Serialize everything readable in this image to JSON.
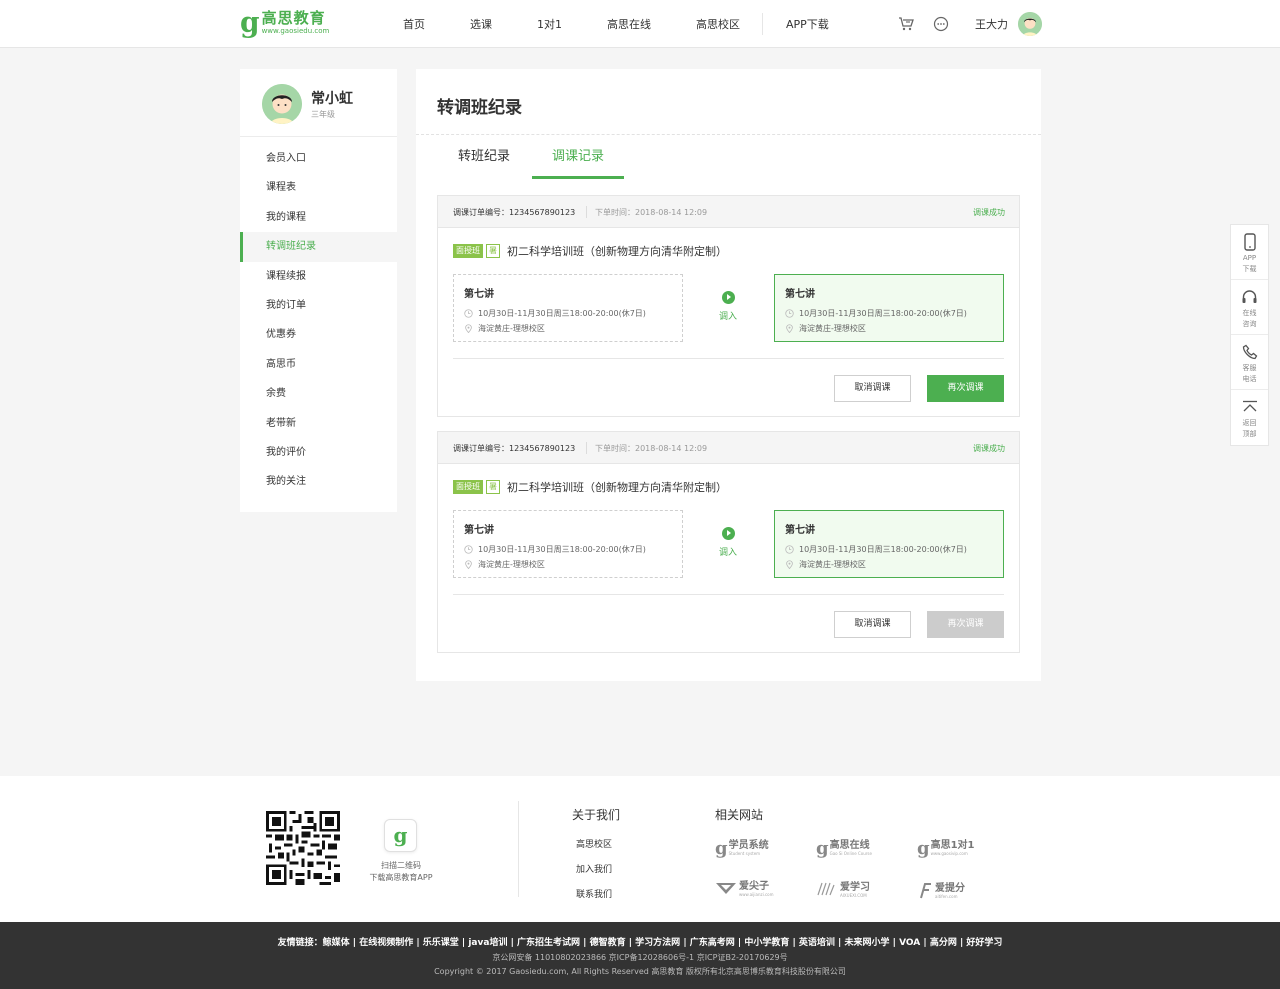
{
  "brand": {
    "name": "高思教育",
    "url": "www.gaosiedu.com",
    "accent": "#4caf50"
  },
  "nav": {
    "items": [
      "首页",
      "选课",
      "1对1",
      "高思在线",
      "高思校区",
      "APP下载"
    ]
  },
  "header": {
    "username": "王大力"
  },
  "profile": {
    "name": "常小虹",
    "grade": "三年级"
  },
  "sidebar": {
    "items": [
      {
        "label": "会员入口"
      },
      {
        "label": "课程表"
      },
      {
        "label": "我的课程"
      },
      {
        "label": "转调班纪录",
        "active": true
      },
      {
        "label": "课程续报"
      },
      {
        "label": "我的订单"
      },
      {
        "label": "优惠券"
      },
      {
        "label": "高思币"
      },
      {
        "label": "余费"
      },
      {
        "label": "老带新"
      },
      {
        "label": "我的评价"
      },
      {
        "label": "我的关注"
      }
    ]
  },
  "main": {
    "title": "转调班纪录",
    "tabs": [
      {
        "label": "转班纪录",
        "active": false
      },
      {
        "label": "调课记录",
        "active": true
      }
    ]
  },
  "records": [
    {
      "order_label": "调课订单编号：1234567890123",
      "time_label": "下单时间：2018-08-14 12:09",
      "status": "调课成功",
      "tag_type": "面授班",
      "tag_season": "暑",
      "course": "初二科学培训班（创新物理方向清华附定制）",
      "from": {
        "title": "第七讲",
        "time": "10月30日-11月30日周三18:00-20:00(休7日)",
        "place": "海淀黄庄-理想校区"
      },
      "to": {
        "title": "第七讲",
        "time": "10月30日-11月30日周三18:00-20:00(休7日)",
        "place": "海淀黄庄-理想校区"
      },
      "transfer_label": "调入",
      "cancel_label": "取消调课",
      "retry_label": "再次调课",
      "retry_enabled": true
    },
    {
      "order_label": "调课订单编号：1234567890123",
      "time_label": "下单时间：2018-08-14 12:09",
      "status": "调课成功",
      "tag_type": "面授班",
      "tag_season": "暑",
      "course": "初二科学培训班（创新物理方向清华附定制）",
      "from": {
        "title": "第七讲",
        "time": "10月30日-11月30日周三18:00-20:00(休7日)",
        "place": "海淀黄庄-理想校区"
      },
      "to": {
        "title": "第七讲",
        "time": "10月30日-11月30日周三18:00-20:00(休7日)",
        "place": "海淀黄庄-理想校区"
      },
      "transfer_label": "调入",
      "cancel_label": "取消调课",
      "retry_label": "再次调课",
      "retry_enabled": false
    }
  ],
  "float_bar": {
    "items": [
      {
        "line1": "APP",
        "line2": "下载",
        "icon": "phone-icon"
      },
      {
        "line1": "在线",
        "line2": "咨询",
        "icon": "headset-icon"
      },
      {
        "line1": "客服",
        "line2": "电话",
        "icon": "call-icon"
      },
      {
        "line1": "返回",
        "line2": "顶部",
        "icon": "back-to-top-icon"
      }
    ]
  },
  "footer": {
    "scan_line1": "扫描二维码",
    "scan_line2": "下载高思教育APP",
    "about_title": "关于我们",
    "about_links": [
      "高思校区",
      "加入我们",
      "联系我们"
    ],
    "related_title": "相关网站",
    "related_sites": [
      {
        "name": "学员系统",
        "sub": "Student system"
      },
      {
        "name": "高思在线",
        "sub": "Gao Si Online Course"
      },
      {
        "name": "高思1对1",
        "sub": "www.gaosivip.com"
      },
      {
        "name": "爱尖子",
        "sub": "www.aijianzi.com"
      },
      {
        "name": "爱学习",
        "sub": "AIXUEXI.COM"
      },
      {
        "name": "爱提分",
        "sub": "aitifen.com"
      }
    ],
    "friend_label": "友情链接：",
    "friend_links": [
      "鲸媒体",
      "在线视频制作",
      "乐乐课堂",
      "java培训",
      "广东招生考试网",
      "德智教育",
      "学习方法网",
      "广东高考网",
      "中小学教育",
      "英语培训",
      "未来网小学",
      "VOA",
      "高分网",
      "好好学习"
    ],
    "icp": "京公网安备 11010802023866   京ICP备12028606号-1   京ICP证B2-20170629号",
    "copyright": "Copyright © 2017 Gaosiedu.com, All Rights Reserved 高思教育 版权所有北京高思博乐教育科技股份有限公司"
  }
}
